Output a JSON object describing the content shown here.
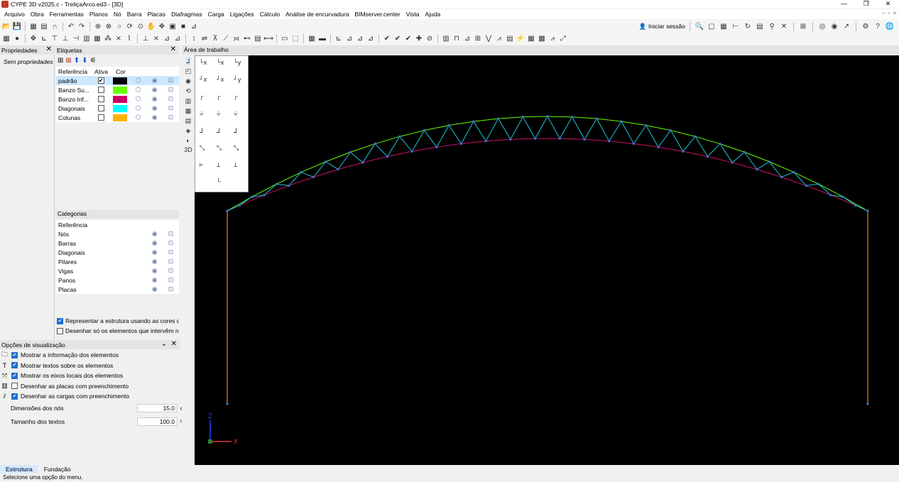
{
  "window": {
    "title": "CYPE 3D v2025.c - TreliçaArco.ed3 - [3D]"
  },
  "menu": [
    "Arquivo",
    "Obra",
    "Ferramentas",
    "Planos",
    "Nó",
    "Barra",
    "Placas",
    "Diafragmas",
    "Carga",
    "Ligações",
    "Cálculo",
    "Análise de encurvadura",
    "BIMserver.center",
    "Vista",
    "Ajuda"
  ],
  "toolbar": {
    "login_label": "Iniciar sessão"
  },
  "properties": {
    "title": "Propriedades",
    "empty_text": "Sem propriedades"
  },
  "labels": {
    "title": "Etiquetas",
    "headers": {
      "ref": "Referência",
      "active": "Ativa",
      "color": "Cor"
    },
    "rows": [
      {
        "ref": "padrão",
        "active": true,
        "color": "#000000"
      },
      {
        "ref": "Banzo Su...",
        "active": false,
        "color": "#66ff00"
      },
      {
        "ref": "Banzo Inf...",
        "active": false,
        "color": "#cc0066"
      },
      {
        "ref": "Diagonais",
        "active": false,
        "color": "#00ffff"
      },
      {
        "ref": "Colunas",
        "active": false,
        "color": "#ffb000"
      }
    ]
  },
  "categories": {
    "title": "Categorias",
    "header": "Referência",
    "rows": [
      "Nós",
      "Barras",
      "Diagonais",
      "Pilares",
      "Vigas",
      "Panos",
      "Placas"
    ]
  },
  "label_options": {
    "represent_colors": "Representar a estrutura usando as cores das layers",
    "draw_only": "Desenhar só os elementos que intervêm na análise"
  },
  "view_options": {
    "title": "Opções de visualização",
    "items": [
      {
        "label": "Mostrar a informação dos elementos",
        "checked": true,
        "icon": "folder-icon"
      },
      {
        "label": "Mostrar textos sobre os elementos",
        "checked": true,
        "icon": "text-icon"
      },
      {
        "label": "Mostrar os eixos locais dos elementos",
        "checked": true,
        "icon": "axes-icon"
      },
      {
        "label": "Desenhar as placas com preenchimento",
        "checked": false,
        "icon": "plate-icon"
      },
      {
        "label": "Desenhar as cargas com preenchimento",
        "checked": true,
        "icon": "load-icon"
      }
    ],
    "node_dim_label": "Dimensões dos nós",
    "node_dim_value": "15.0",
    "node_dim_unit": "cm",
    "text_size_label": "Tamanho dos textos",
    "text_size_value": "100.0",
    "text_size_unit": "%"
  },
  "workarea": {
    "title": "Área de trabalho",
    "axis_x": "X",
    "axis_z": "Z"
  },
  "tabs": [
    "Estrutura",
    "Fundação"
  ],
  "status": "Selecione uma opção do menu.",
  "colors": {
    "top_chord": "#66ff00",
    "bottom_chord": "#cc1166",
    "diagonals": "#19c6d8",
    "columns": "#ffb000"
  }
}
